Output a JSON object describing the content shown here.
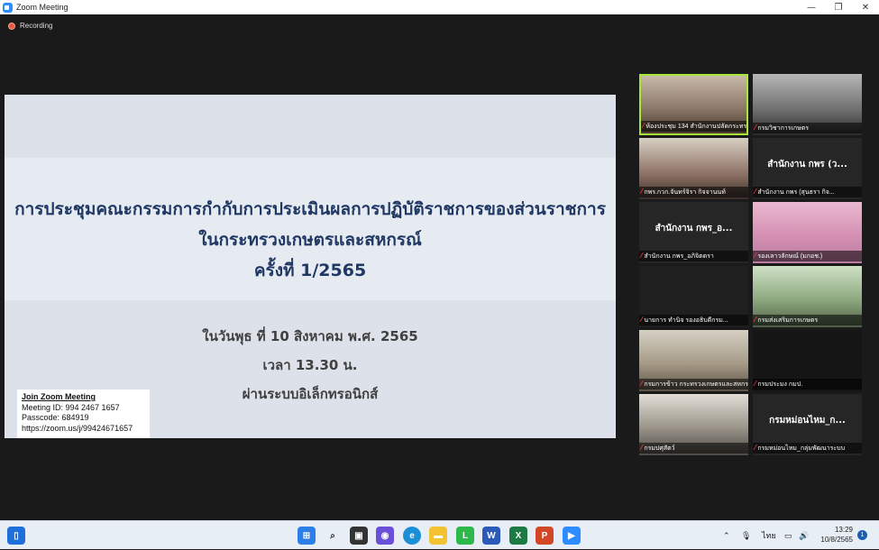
{
  "window": {
    "title": "Zoom Meeting",
    "minimize": "—",
    "maximize": "❐",
    "close": "✕"
  },
  "recording": {
    "label": "Recording"
  },
  "slide": {
    "title_line1": "การประชุมคณะกรรมการกำกับการประเมินผลการปฏิบัติราชการของส่วนราชการ",
    "title_line2": "ในกระทรวงเกษตรและสหกรณ์",
    "title_line3": "ครั้งที่ 1/2565",
    "date": "ในวันพุธ ที่ 10 สิงหาคม พ.ศ. 2565",
    "time": "เวลา 13.30 น.",
    "channel": "ผ่านระบบอิเล็กทรอนิกส์"
  },
  "join_info": {
    "heading": "Join Zoom Meeting",
    "meeting_id": "Meeting ID: 994 2467 1657",
    "passcode": "Passcode: 684919",
    "url": "https://zoom.us/j/99424671657"
  },
  "participants": [
    {
      "name": "ห้องประชุม 134 สำนักงานปลัดกระทรวง",
      "video": true,
      "active": true
    },
    {
      "name": "กรมวิชาการเกษตร",
      "video": true
    },
    {
      "name": "กพร.กวก.จันทร์จิรา กิจจานนท์",
      "video": true
    },
    {
      "name": "สำนักงาน กพร (สุนธรา กิจ...",
      "display_name": "สำนักงาน กพร (ว...",
      "video": false
    },
    {
      "name": "สำนักงาน กพร_อภิจิตตรา",
      "display_name": "สำนักงาน กพร_อ...",
      "video": false
    },
    {
      "name": "รองเลาวลักษณ์ (มกอช.)",
      "video": true
    },
    {
      "name": "นายการ ทำนิจ รองอธิบดีกรม...",
      "video": true
    },
    {
      "name": "กรมส่งเสริมการเกษตร",
      "video": true
    },
    {
      "name": "กรมการข้าว กระทรวงเกษตรและสหกรณ์",
      "video": true
    },
    {
      "name": "กรมประมง กมป.",
      "video": true
    },
    {
      "name": "กรมปศุสัตว์",
      "video": true
    },
    {
      "name": "กรมหม่อนไหม_กลุ่มพัฒนาระบบ",
      "display_name": "กรมหม่อนไหม_ก...",
      "video": false
    }
  ],
  "taskbar": {
    "language": "ไทย",
    "time": "13:29",
    "date": "10/8/2565",
    "notifications": "1"
  },
  "colors": {
    "active_speaker": "#a8e63a",
    "slide_title": "#1f3864",
    "muted_mic": "#ff3a3a"
  }
}
